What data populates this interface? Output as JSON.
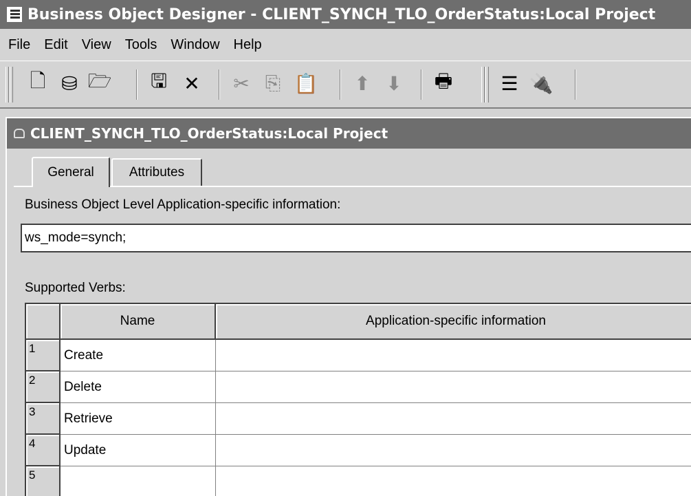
{
  "window": {
    "title": "Business Object Designer - CLIENT_SYNCH_TLO_OrderStatus:Local Project"
  },
  "menu": {
    "items": [
      "File",
      "Edit",
      "View",
      "Tools",
      "Window",
      "Help"
    ]
  },
  "toolbar": {
    "buttons": [
      {
        "name": "new-icon",
        "glyph": "🗋",
        "enabled": true
      },
      {
        "name": "open-project-icon",
        "glyph": "⛁",
        "enabled": true
      },
      {
        "name": "open-folder-icon",
        "glyph": "🗁",
        "enabled": true
      },
      {
        "name": "save-icon",
        "glyph": "🖫",
        "enabled": true
      },
      {
        "name": "delete-icon",
        "glyph": "✕",
        "enabled": true
      },
      {
        "name": "cut-icon",
        "glyph": "✂",
        "enabled": false
      },
      {
        "name": "copy-icon",
        "glyph": "⎘",
        "enabled": false
      },
      {
        "name": "paste-icon",
        "glyph": "📋",
        "enabled": true
      },
      {
        "name": "move-up-icon",
        "glyph": "⬆",
        "enabled": false
      },
      {
        "name": "move-down-icon",
        "glyph": "⬇",
        "enabled": false
      },
      {
        "name": "print-icon",
        "glyph": "🖶",
        "enabled": true
      },
      {
        "name": "properties-icon",
        "glyph": "☰",
        "enabled": true
      },
      {
        "name": "connect-icon",
        "glyph": "🔌",
        "enabled": true
      }
    ]
  },
  "child_window": {
    "title": "CLIENT_SYNCH_TLO_OrderStatus:Local Project"
  },
  "tabs": {
    "general": "General",
    "attributes": "Attributes"
  },
  "general": {
    "asi_label": "Business Object Level Application-specific information:",
    "asi_value": "ws_mode=synch;",
    "verbs_label": "Supported Verbs:"
  },
  "verbs_table": {
    "columns": [
      "Name",
      "Application-specific information"
    ],
    "rows": [
      {
        "num": "1",
        "name": "Create",
        "asi": ""
      },
      {
        "num": "2",
        "name": "Delete",
        "asi": ""
      },
      {
        "num": "3",
        "name": "Retrieve",
        "asi": ""
      },
      {
        "num": "4",
        "name": "Update",
        "asi": ""
      },
      {
        "num": "5",
        "name": "",
        "asi": ""
      }
    ]
  },
  "colors": {
    "titlebar": "#6e6e6e",
    "face": "#d4d4d4"
  }
}
